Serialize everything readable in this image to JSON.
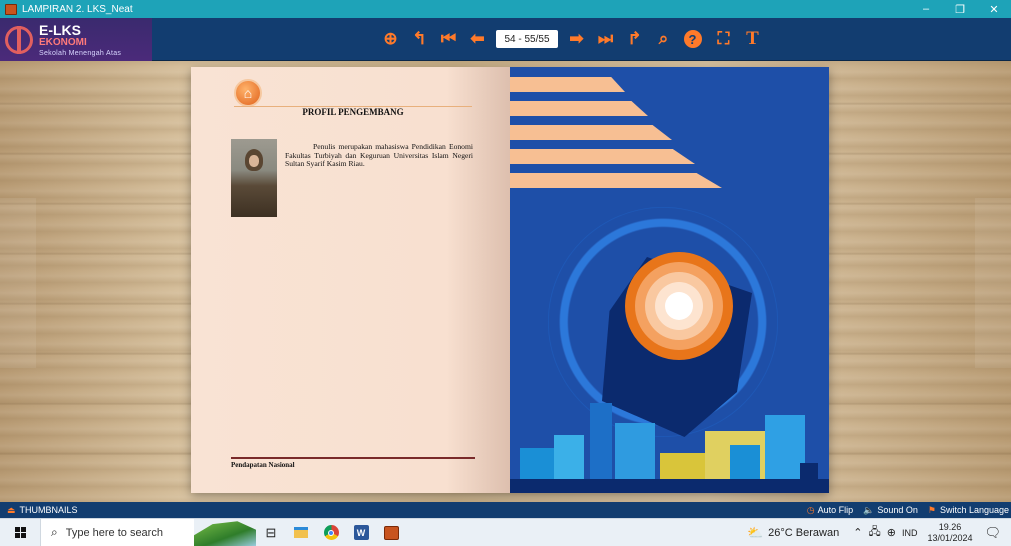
{
  "window": {
    "title": "LAMPIRAN 2. LKS_Neat",
    "minimize": "–",
    "restore": "❐",
    "close": "✕"
  },
  "logo": {
    "title": "E-LKS",
    "subtitle": "EKONOMI",
    "tagline": "Sekolah Menengah Atas"
  },
  "toolbar": {
    "zoom_in": "⊕",
    "undo": "↰",
    "first": "⏮",
    "prev": "⬅",
    "page_indicator": "54 - 55/55",
    "next": "➡",
    "last": "⏭",
    "share": "↱",
    "search": "⌕",
    "help": "?",
    "fullscreen": "⛶",
    "text": "T"
  },
  "left_page": {
    "heading": "PROFIL PENGEMBANG",
    "bio": "Penulis merupakan mahasiswa Pendidikan Eonomi Fakultas Turbiyah dan Keguruan Universitas Islam Negeri Sultan Syarif Kasim Riau.",
    "footer": "Pendapatan Nasional"
  },
  "bottombar": {
    "thumbnails": "THUMBNAILS",
    "auto_flip": "Auto Flip",
    "sound": "Sound On",
    "switch_language": "Switch Language"
  },
  "taskbar": {
    "search_placeholder": "Type here to search",
    "weather": "26°C Berawan",
    "language": "IND",
    "time": "19.26",
    "date": "13/01/2024"
  },
  "colors": {
    "accent": "#ff7a2a",
    "toolbar_bg": "#123d70",
    "titlebar_bg": "#1ea3b8",
    "cover_bg": "#1e4fa8"
  }
}
